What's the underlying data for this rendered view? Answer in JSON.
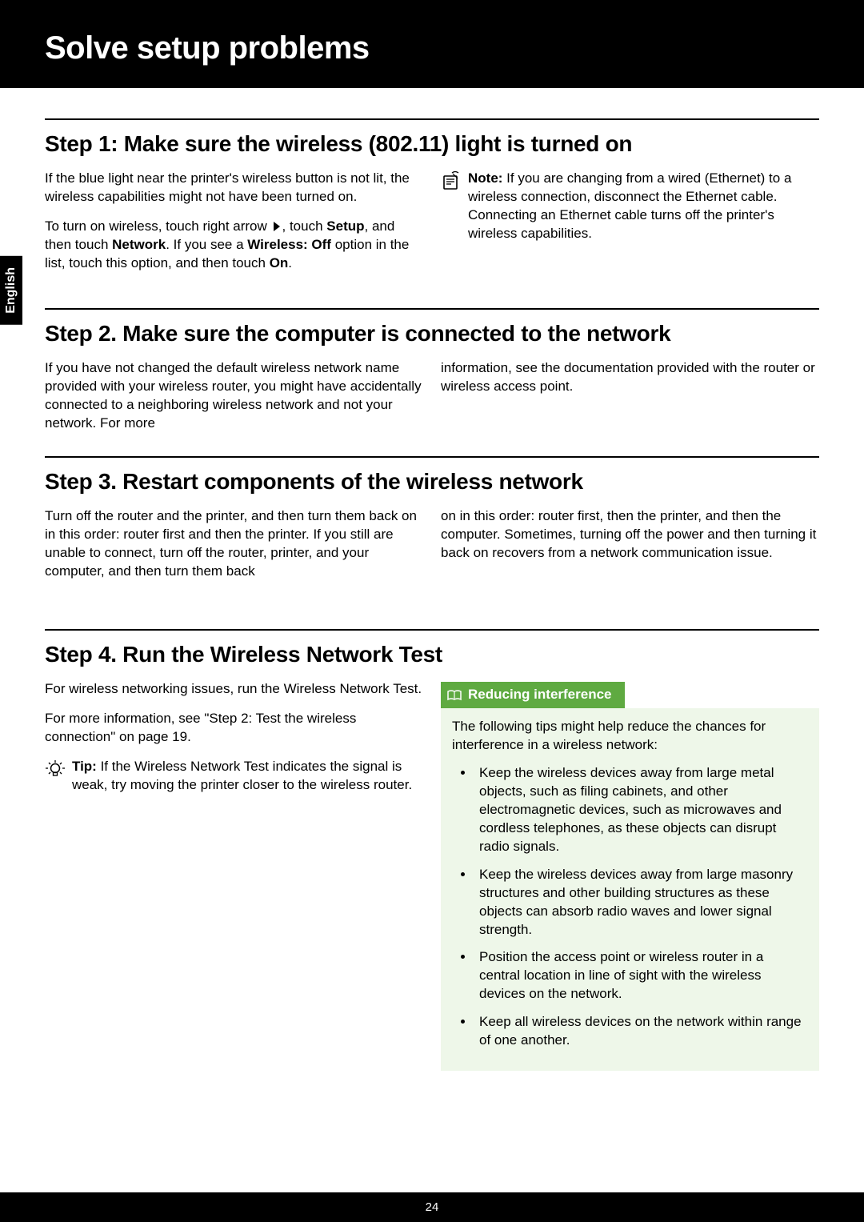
{
  "header": {
    "title": "Solve setup problems"
  },
  "sideTab": "English",
  "step1": {
    "heading": "Step 1: Make sure the wireless (802.11) light is turned on",
    "left": {
      "p1": "If the blue light near the printer's wireless button is not lit, the wireless capabilities might not have been turned on.",
      "p2_a": "To turn on wireless, touch right arrow ",
      "p2_b": ", touch ",
      "p2_setup": "Setup",
      "p2_c": ", and then touch ",
      "p2_network": "Network",
      "p2_d": ". If you see a ",
      "p2_wifioff": "Wireless: Off",
      "p2_e": " option in the list, touch this option, and then touch ",
      "p2_on": "On",
      "p2_f": "."
    },
    "right": {
      "note_label": "Note:",
      "note_text": " If you are changing from a wired (Ethernet) to a wireless connection, disconnect the Ethernet cable. Connecting an Ethernet cable turns off the printer's wireless capabilities."
    }
  },
  "step2": {
    "heading": "Step 2. Make sure the computer is connected to the network",
    "left": "If you have not changed the default wireless network name provided with your wireless router, you might have accidentally connected to a neighboring wireless network and not your network. For more",
    "right": "information, see the documentation provided with the router or wireless access point."
  },
  "step3": {
    "heading": "Step 3. Restart components of the wireless network",
    "left": "Turn off the router and the printer, and then turn them back on in this order: router first and then the printer. If you still are unable to connect, turn off the router, printer, and your computer, and then turn them back",
    "right": "on in this order: router first, then the printer, and then the computer. Sometimes, turning off the power and then turning it back on recovers from a network communication issue."
  },
  "step4": {
    "heading": "Step 4. Run the Wireless Network Test",
    "left": {
      "p1": "For wireless networking issues, run the Wireless Network Test.",
      "p2": "For more information, see \"Step 2: Test the wireless connection\" on page 19.",
      "tip_label": "Tip:",
      "tip_text": " If the Wireless Network Test indicates the signal is weak, try moving the printer closer to the wireless router."
    },
    "box": {
      "title": "Reducing interference",
      "intro": "The following tips might help reduce the chances for interference in a wireless network:",
      "items": [
        "Keep the wireless devices away from large metal objects, such as filing cabinets, and other electromagnetic devices, such as microwaves and cordless telephones, as these objects can disrupt radio signals.",
        "Keep the wireless devices away from large masonry structures and other building structures as these objects can absorb radio waves and lower signal strength.",
        "Position the access point or wireless router in a central location in line of sight with the wireless devices on the network.",
        "Keep all wireless devices on the network within range of one another."
      ]
    }
  },
  "footer": {
    "page": "24"
  }
}
